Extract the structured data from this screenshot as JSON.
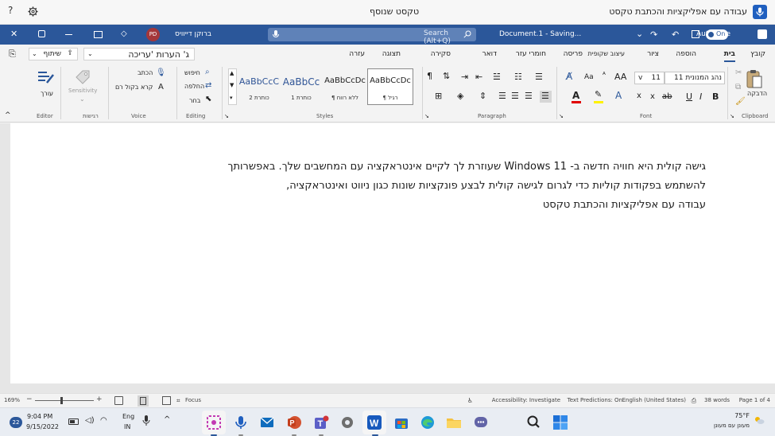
{
  "voice_panel": {
    "title_right": "עבודה עם אפליקציות והכתבת טקסט",
    "title_mid": "טקסט שנוסף"
  },
  "titlebar": {
    "autosave_label": "AutoSave",
    "autosave_state": "On",
    "document_name": "Document.1 - Saving...",
    "search_placeholder": "Search (Alt+Q)",
    "user_name": "ברוקן דייוויס",
    "user_initials": "PD"
  },
  "ribbon_tabs": [
    {
      "label": "קובץ"
    },
    {
      "label": "בית",
      "active": true
    },
    {
      "label": "הוספה"
    },
    {
      "label": "ציור"
    },
    {
      "label": "עיצוב שקופית"
    },
    {
      "label": "פריסה"
    },
    {
      "label": "חומרי עזר"
    },
    {
      "label": "דואר"
    },
    {
      "label": "סקירה"
    },
    {
      "label": "תצוגה"
    },
    {
      "label": "עזרה"
    }
  ],
  "ribbon_right": {
    "editing_mode": "ג' הערות 'עריכה",
    "share_label": "שיתוף"
  },
  "clipboard": {
    "paste_label": "הדבקה",
    "group_label": "Clipboard"
  },
  "font": {
    "font_name": "נהג המנונית 11",
    "font_size": "11",
    "grow_label": "AA",
    "case_label": "Aa",
    "bold": "B",
    "italic": "I",
    "underline": "U",
    "strike": "ab",
    "subscript": "x",
    "superscript": "x",
    "group_label": "Font"
  },
  "paragraph": {
    "group_label": "Paragraph"
  },
  "styles": {
    "items": [
      {
        "sample": "AaBbCcDc",
        "name": "¶ רגיל"
      },
      {
        "sample": "AaBbCcDc",
        "name": "¶ ללא רווח"
      },
      {
        "sample": "AaBbCc",
        "name": "כותרת 1"
      },
      {
        "sample": "AaBbCcC",
        "name": "כותרת 2"
      }
    ],
    "group_label": "Styles"
  },
  "editing": {
    "find": "חיפוש",
    "replace": "החלפה",
    "select": "בחר",
    "group_label": "Editing"
  },
  "voice": {
    "dictate": "הכתב",
    "read_aloud": "קרא בקול רם",
    "group_label": "Voice"
  },
  "sensitivity": {
    "label": "Sensitivity",
    "group_label": "רגישות"
  },
  "editor": {
    "label": "עורך",
    "group_label": "Editor"
  },
  "document": {
    "lines": [
      "גישה קולית היא חוויה חדשה ב- Windows 11 שעוזרת לך לקיים אינטראקציה עם המחשבים שלך. באפשרותך",
      "להשתמש בפקודות קוליות כדי לגרום לגישה קולית לבצע פונקציות שונות כגון ניווט ואינטראקציה,",
      "עבודה עם אפליקציות והכתבת טקסט"
    ]
  },
  "statusbar": {
    "page": "Page 1 of 4",
    "words": "38 words",
    "language": "English (United States)",
    "text_predictions": "Text Predictions: On",
    "accessibility": "Accessibility: Investigate",
    "focus": "Focus",
    "zoom": "169%"
  },
  "taskbar": {
    "weather_temp": "75°F",
    "weather_desc": "מעונן עם מעונן",
    "time": "9:04 PM",
    "date": "9/15/2022",
    "lang_top": "Eng",
    "lang_bottom": "IN",
    "notification_count": "22"
  }
}
